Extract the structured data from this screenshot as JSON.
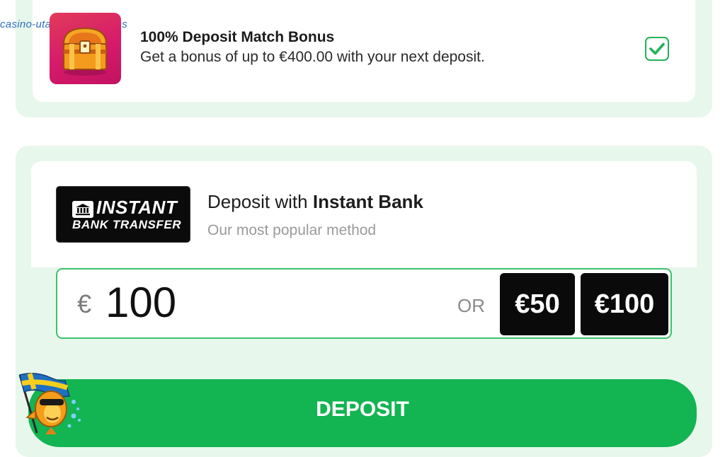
{
  "watermark": {
    "text": "casino-utan-svensk-licens"
  },
  "bonus": {
    "title": "100% Deposit Match Bonus",
    "description": "Get a bonus of up to €400.00 with your next deposit.",
    "checked": true,
    "icon": "treasure-chest-icon"
  },
  "method": {
    "logo_line1": "INSTANT",
    "logo_line2": "BANK TRANSFER",
    "title_prefix": "Deposit with ",
    "title_name": "Instant Bank",
    "subtitle": "Our most popular method"
  },
  "amount": {
    "currency": "€",
    "value": "100",
    "or_label": "OR",
    "quick_options": [
      "€50",
      "€100"
    ]
  },
  "deposit_button": {
    "label": "DEPOSIT"
  },
  "colors": {
    "accent": "#13b452",
    "panel_bg": "#e8f7ec",
    "bonus_thumb": "#d61a6b"
  }
}
